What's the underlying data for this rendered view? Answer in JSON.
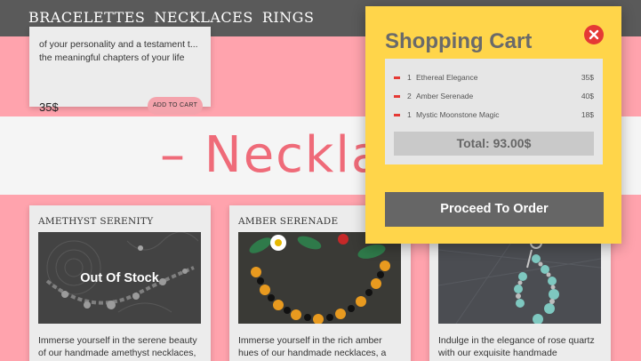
{
  "nav": {
    "links": [
      "BRACELETTES",
      "NECKLACES",
      "RINGS"
    ]
  },
  "top_card": {
    "desc": "of your personality and a testament t... the meaningful chapters of your life",
    "price": "35$",
    "add_label": "ADD TO CART"
  },
  "section": {
    "title": "– Necklac"
  },
  "products": [
    {
      "name": "AMETHYST SERENITY",
      "stock_label": "Out Of Stock",
      "desc": "Immerse yourself in the serene beauty of our handmade amethyst necklaces,"
    },
    {
      "name": "AMBER SERENADE",
      "desc": "Immerse yourself in the rich amber hues of our handmade necklaces, a"
    },
    {
      "name": "",
      "desc": "Indulge in the elegance of rose quartz with our exquisite handmade"
    }
  ],
  "cart": {
    "title": "Shopping Cart",
    "items": [
      {
        "qty": "1",
        "name": "Ethereal Elegance",
        "price": "35$"
      },
      {
        "qty": "2",
        "name": "Amber Serenade",
        "price": "40$"
      },
      {
        "qty": "1",
        "name": "Mystic Moonstone Magic",
        "price": "18$"
      }
    ],
    "total": "Total: 93.00$",
    "order_label": "Proceed To Order"
  },
  "colors": {
    "page_bg": "#ffa3ad",
    "nav_bg": "#5a5a5a",
    "accent_pink": "#ef6b79",
    "cart_bg": "#ffd54a",
    "close_red": "#e53935",
    "order_btn": "#666666"
  },
  "icons": {
    "close": "close-icon",
    "remove": "minus-icon"
  }
}
